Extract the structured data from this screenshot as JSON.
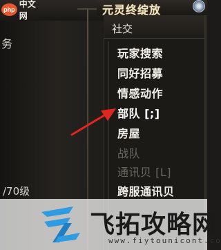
{
  "site_logo": {
    "badge": "php",
    "text": "中文网"
  },
  "title_bar": {
    "title": "元灵终绽放"
  },
  "left_panel": {
    "task_text": "务",
    "level_text": "/70级"
  },
  "menu": {
    "header": "社交",
    "items": [
      {
        "label": "玩家搜索",
        "disabled": false
      },
      {
        "label": "同好招募",
        "disabled": false
      },
      {
        "label": "情感动作",
        "disabled": false
      },
      {
        "label": "部队 [;]",
        "disabled": false
      },
      {
        "label": "房屋",
        "disabled": false
      },
      {
        "label": "战队",
        "disabled": true
      },
      {
        "label": "通讯贝 [L]",
        "disabled": true
      },
      {
        "label": "跨服通讯贝",
        "disabled": false
      },
      {
        "label": "…",
        "disabled": false
      }
    ]
  },
  "watermark": {
    "title": "飞拓攻略网",
    "url": "www.fiytounicont.com"
  },
  "colors": {
    "menu_bg": "#1c1a17",
    "arrow": "#e0261f",
    "php_badge": "#e9572a",
    "watermark_blue": "#2f9be0"
  }
}
